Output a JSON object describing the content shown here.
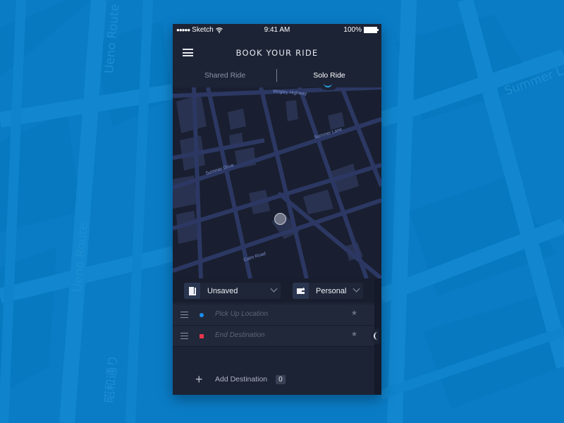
{
  "background": {
    "color": "#0a7cc6",
    "labels": [
      "Ueno Route",
      "Ueno Route",
      "昭和通り",
      "Summer Lane"
    ]
  },
  "status_bar": {
    "carrier": "Sketch",
    "signal_dots": "●●●●●",
    "time": "9:41 AM",
    "battery": "100%"
  },
  "header": {
    "title": "BOOK YOUR RIDE",
    "menu_icon": "hamburger-icon"
  },
  "tabs": [
    {
      "label": "Shared Ride",
      "active": false
    },
    {
      "label": "Solo Ride",
      "active": true
    }
  ],
  "map": {
    "street_labels": [
      "Wrigley Highway",
      "Summer Lane",
      "Summer Drive",
      "Calm Road"
    ]
  },
  "selectors": {
    "saved": {
      "label": "Unsaved",
      "icon": "book-icon"
    },
    "payment": {
      "label": "Personal",
      "icon": "wallet-icon"
    }
  },
  "route": [
    {
      "placeholder": "Pick Up Location",
      "marker": "blue-dot",
      "color": "#1c8ef0"
    },
    {
      "placeholder": "End Destination",
      "marker": "red-square",
      "color": "#e8354c"
    }
  ],
  "add_destination": {
    "label": "Add Destination",
    "count": "0"
  }
}
